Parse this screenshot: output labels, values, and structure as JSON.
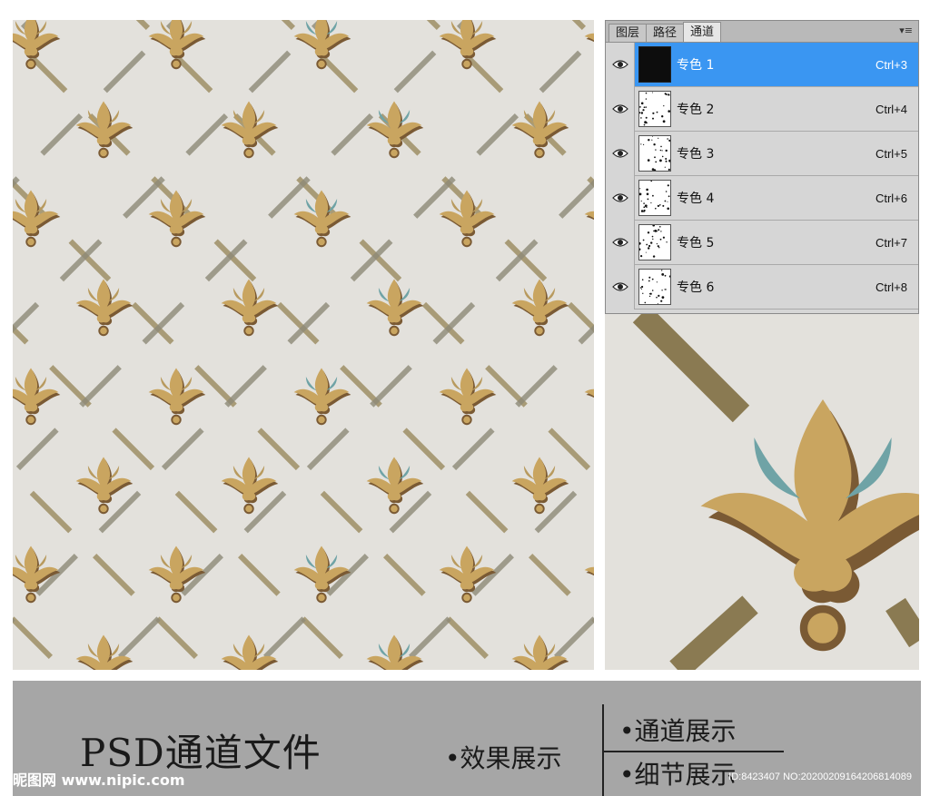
{
  "panel": {
    "tabs": [
      {
        "label": "图层"
      },
      {
        "label": "路径"
      },
      {
        "label": "通道"
      }
    ],
    "menu_glyph": "▾≡",
    "channels": [
      {
        "name": "专色 1",
        "shortcut": "Ctrl+3",
        "selected": true,
        "thumb": "dark"
      },
      {
        "name": "专色 2",
        "shortcut": "Ctrl+4",
        "selected": false,
        "thumb": "light"
      },
      {
        "name": "专色 3",
        "shortcut": "Ctrl+5",
        "selected": false,
        "thumb": "light"
      },
      {
        "name": "专色 4",
        "shortcut": "Ctrl+6",
        "selected": false,
        "thumb": "light"
      },
      {
        "name": "专色 5",
        "shortcut": "Ctrl+7",
        "selected": false,
        "thumb": "light"
      },
      {
        "name": "专色 6",
        "shortcut": "Ctrl+8",
        "selected": false,
        "thumb": "light"
      }
    ]
  },
  "footer": {
    "title": "PSD通道文件",
    "effect_label": "•效果展示",
    "channel_label": "•通道展示",
    "detail_label": "•细节展示"
  },
  "watermark": {
    "logo": "昵图网 www.nipic.com",
    "id": "ID:8423407 NO:20200209164206814089"
  },
  "colors": {
    "background": "#e3e1dc",
    "gold": "#c9a560",
    "brown": "#7a5a34",
    "teal": "#6fa3a6",
    "selected": "#3a96f2",
    "footer": "#a6a6a6"
  }
}
